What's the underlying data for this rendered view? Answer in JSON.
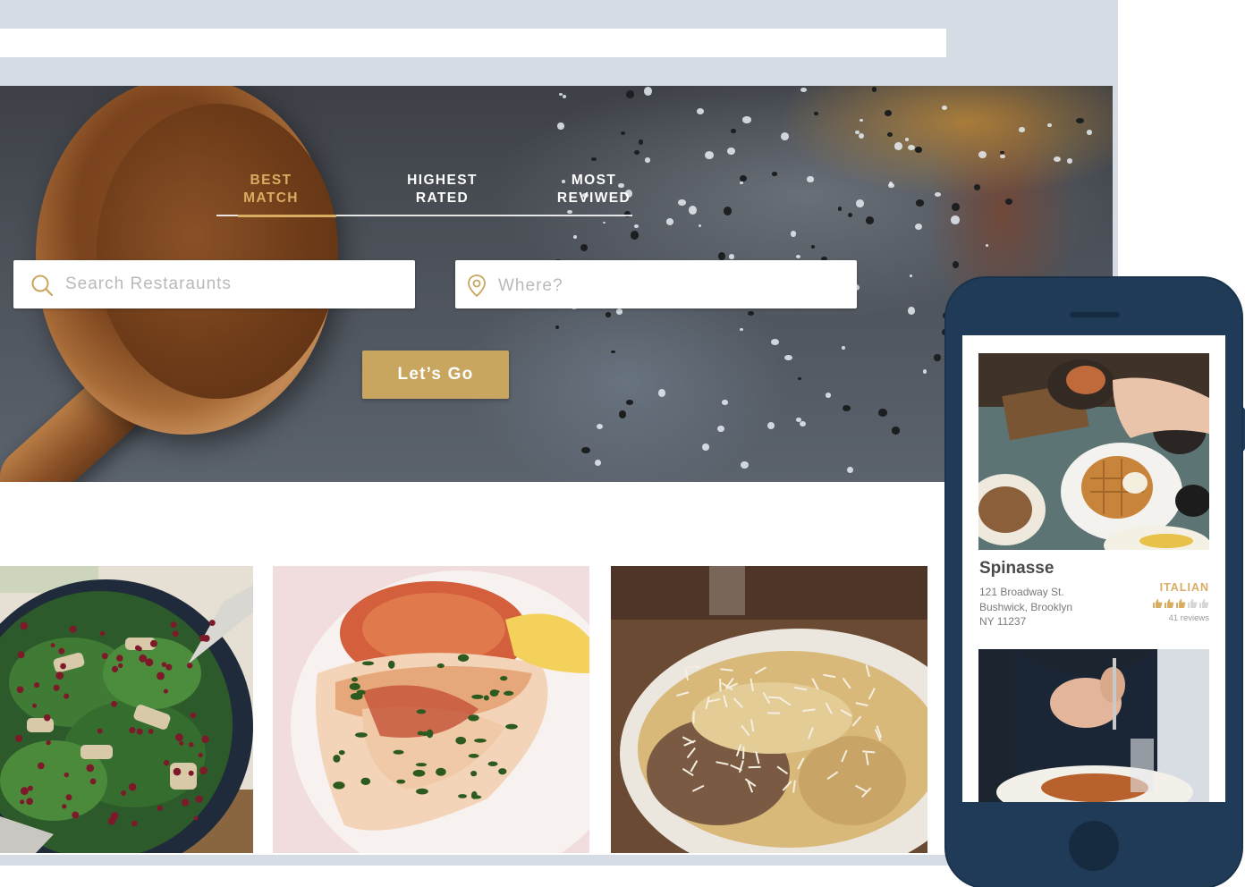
{
  "colors": {
    "accent_gold": "#d8ad62",
    "button_gold": "#c9a65f",
    "phone_navy": "#1f3b57",
    "browser_chrome": "#d5dce3"
  },
  "hero": {
    "tabs": [
      {
        "line1": "BEST",
        "line2": "MATCH",
        "active": true
      },
      {
        "line1": "HIGHEST",
        "line2": "RATED",
        "active": false
      },
      {
        "line1": "MOST",
        "line2": "REVIWED",
        "active": false
      }
    ],
    "search": {
      "restaurants_placeholder": "Search Restaraunts",
      "restaurants_icon": "search-icon",
      "where_placeholder": "Where?",
      "where_icon": "location-pin-icon"
    },
    "go_label": "Let’s Go"
  },
  "food_cards": [
    {
      "icon": "salad-photo"
    },
    {
      "icon": "fish-photo"
    },
    {
      "icon": "pasta-photo"
    }
  ],
  "phone": {
    "listing": {
      "name": "Spinasse",
      "address_lines": [
        "121 Broadway St.",
        "Bushwick, Brooklyn",
        "NY 11237"
      ],
      "cuisine": "ITALIAN",
      "rating": 3,
      "rating_max": 5,
      "reviews": "41 reviews"
    }
  }
}
